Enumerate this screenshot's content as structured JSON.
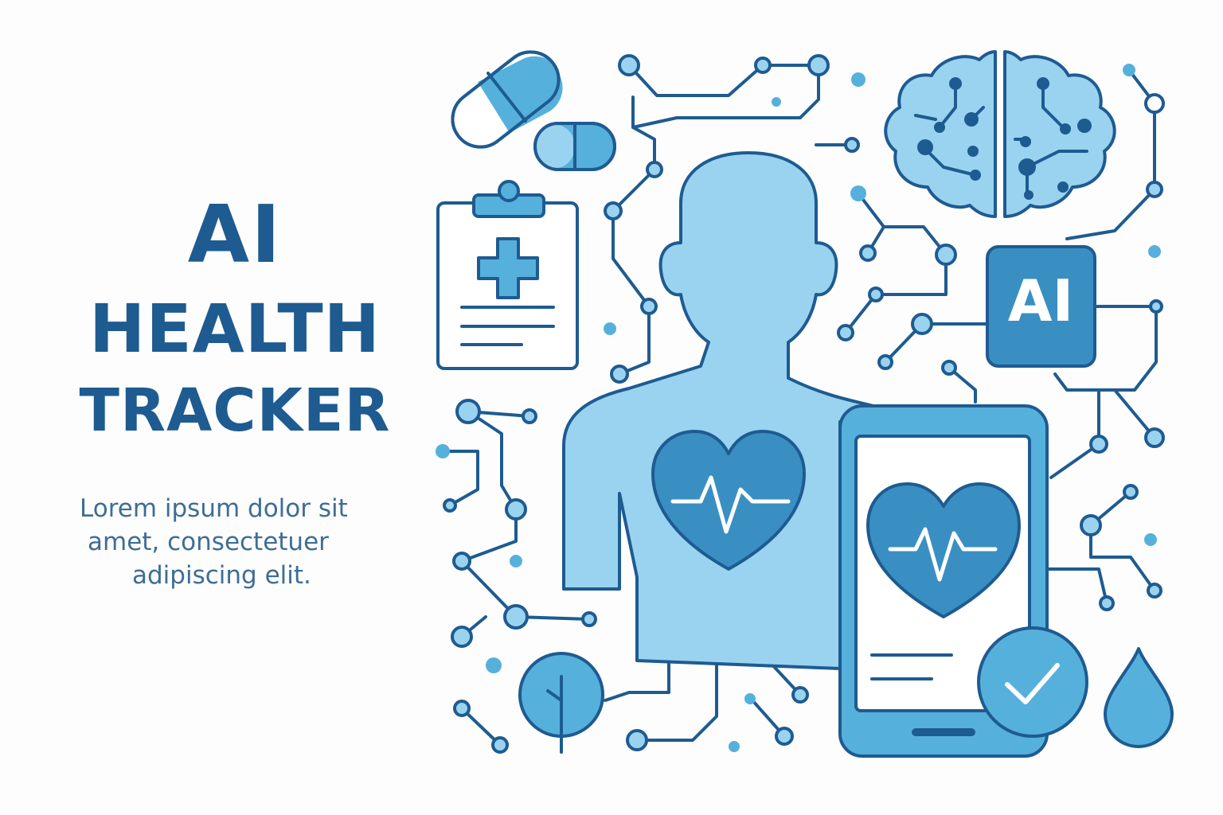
{
  "title": {
    "line1": "AI",
    "line2": "HEALTH",
    "line3": "TRACKER"
  },
  "subtitle": {
    "line1": "Lorem ipsum dolor sit",
    "line2": "amet, consectetuer",
    "line3": "adipiscing elit."
  },
  "badge": {
    "label": "AI"
  },
  "colors": {
    "stroke": "#1e5b91",
    "light_fill": "#9ad3ef",
    "mid_fill": "#56b0dc",
    "dark_fill": "#3a8fc2",
    "text_dark": "#1e5b91",
    "text_muted": "#3e6d96"
  },
  "icons": [
    "capsule-icon",
    "pill-icon",
    "clipboard-medical-icon",
    "person-silhouette-icon",
    "heart-pulse-icon",
    "brain-circuit-icon",
    "ai-chip-icon",
    "smartphone-icon",
    "checkmark-badge-icon",
    "leaf-icon",
    "water-drop-icon",
    "circuit-network-icon"
  ]
}
